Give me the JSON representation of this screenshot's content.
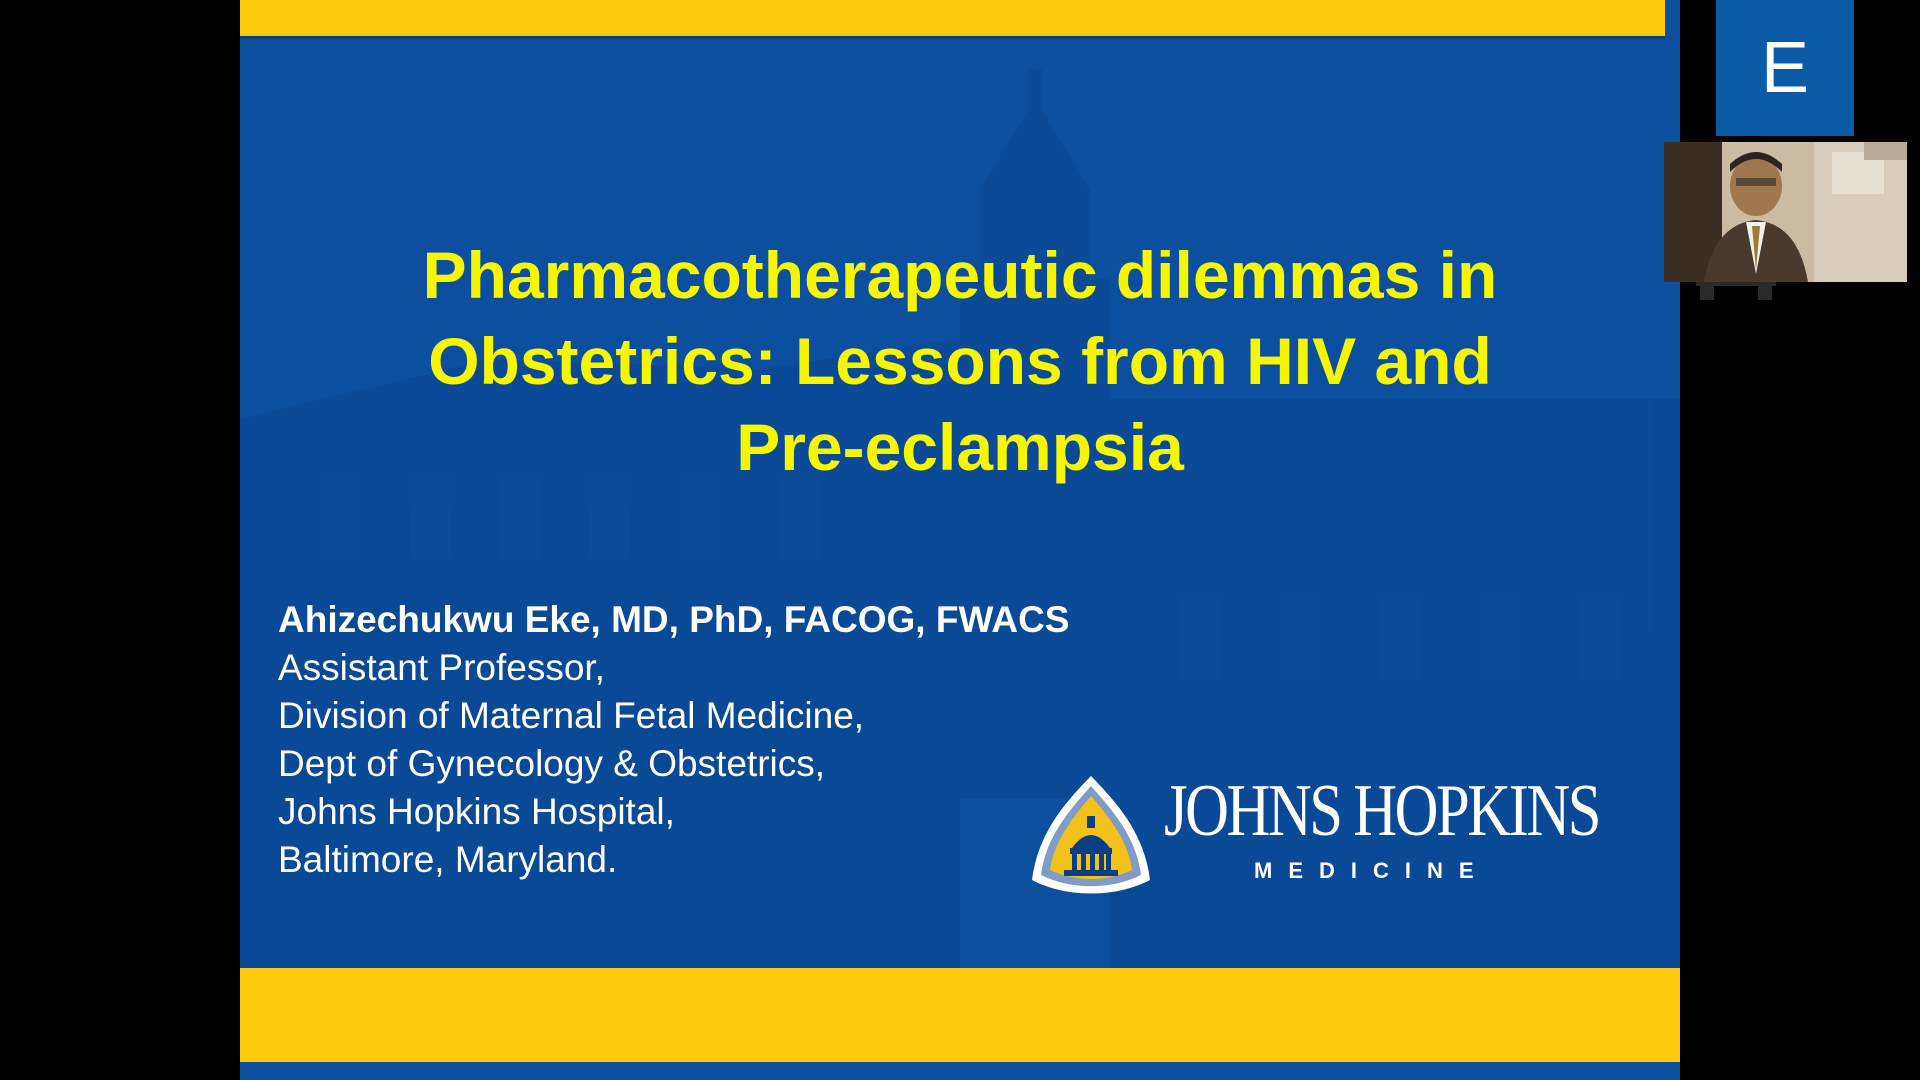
{
  "slide": {
    "title_lines": [
      "Pharmacotherapeutic dilemmas in",
      "Obstetrics: Lessons from HIV and",
      "Pre-eclampsia"
    ],
    "presenter": {
      "name": "Ahizechukwu Eke, MD, PhD, FACOG, FWACS",
      "lines": [
        "Assistant Professor,",
        "Division of Maternal Fetal Medicine,",
        "Dept of Gynecology & Obstetrics,",
        "Johns Hopkins Hospital,",
        "Baltimore, Maryland."
      ]
    },
    "logo": {
      "wordmark": "JOHNS HOPKINS",
      "subtitle": "MEDICINE",
      "icon": "dome-shield-icon"
    },
    "colors": {
      "background_blue": "#0c4f9e",
      "band_yellow": "#fcca0d",
      "title_yellow": "#f6f600"
    }
  },
  "participants": {
    "initial_tile": {
      "initial": "E",
      "color": "#0b5aa6"
    },
    "video_tile": {
      "icon": "participant-video-feed"
    }
  }
}
